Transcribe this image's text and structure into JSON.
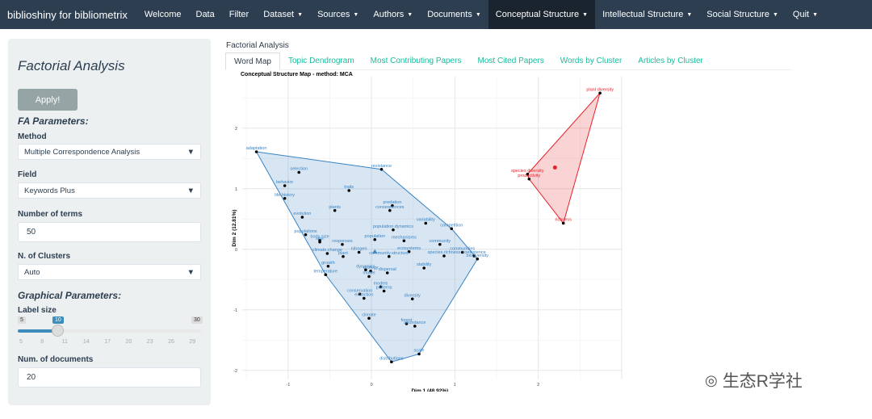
{
  "navbar": {
    "brand": "biblioshiny for bibliometrix",
    "items": [
      {
        "label": "Welcome",
        "dropdown": false
      },
      {
        "label": "Data",
        "dropdown": false
      },
      {
        "label": "Filter",
        "dropdown": false
      },
      {
        "label": "Dataset",
        "dropdown": true
      },
      {
        "label": "Sources",
        "dropdown": true
      },
      {
        "label": "Authors",
        "dropdown": true
      },
      {
        "label": "Documents",
        "dropdown": true
      },
      {
        "label": "Conceptual Structure",
        "dropdown": true,
        "active": true
      },
      {
        "label": "Intellectual Structure",
        "dropdown": true
      },
      {
        "label": "Social Structure",
        "dropdown": true
      },
      {
        "label": "Quit",
        "dropdown": true
      }
    ]
  },
  "sidebar": {
    "title": "Factorial Analysis",
    "apply": "Apply!",
    "fa_params": "FA Parameters:",
    "method_label": "Method",
    "method_value": "Multiple Correspondence Analysis",
    "field_label": "Field",
    "field_value": "Keywords Plus",
    "terms_label": "Number of terms",
    "terms_value": "50",
    "clusters_label": "N. of Clusters",
    "clusters_value": "Auto",
    "graph_params": "Graphical Parameters:",
    "label_size_label": "Label size",
    "label_size": {
      "min": "5",
      "max": "30",
      "value": "10",
      "ticks": [
        "5",
        "8",
        "11",
        "14",
        "17",
        "20",
        "23",
        "26",
        "29"
      ]
    },
    "docs_label": "Num. of documents",
    "docs_value": "20"
  },
  "main": {
    "title": "Factorial Analysis",
    "tabs": [
      "Word Map",
      "Topic Dendrogram",
      "Most Contributing Papers",
      "Most Cited Papers",
      "Words by Cluster",
      "Articles by Cluster"
    ]
  },
  "watermark": "生态R学社",
  "chart_data": {
    "type": "scatter",
    "title": "Conceptual Structure Map - method: MCA",
    "xlabel": "Dim 1 (48.92%)",
    "ylabel": "Dim 2 (12.81%)",
    "xlim": [
      -1.55,
      3.0
    ],
    "ylim": [
      -2.15,
      2.85
    ],
    "xticks": [
      "-1",
      "0",
      "1",
      "2"
    ],
    "yticks": [
      "-2",
      "-1",
      "0",
      "1",
      "2"
    ],
    "grid": true,
    "clusters": [
      {
        "color": "#3a84c4",
        "centroid": [
          0.04,
          -0.04
        ],
        "points": [
          {
            "label": "adaptation",
            "x": -1.38,
            "y": 1.61
          },
          {
            "label": "selection",
            "x": -0.87,
            "y": 1.27
          },
          {
            "label": "behavior",
            "x": -1.04,
            "y": 1.05
          },
          {
            "label": "life history",
            "x": -1.04,
            "y": 0.84
          },
          {
            "label": "traits",
            "x": -0.27,
            "y": 0.97
          },
          {
            "label": "resistance",
            "x": 0.12,
            "y": 1.32
          },
          {
            "label": "plants",
            "x": -0.44,
            "y": 0.64
          },
          {
            "label": "predation",
            "x": 0.25,
            "y": 0.72
          },
          {
            "label": "consequences",
            "x": 0.22,
            "y": 0.64
          },
          {
            "label": "evolution",
            "x": -0.83,
            "y": 0.53
          },
          {
            "label": "variability",
            "x": 0.65,
            "y": 0.43
          },
          {
            "label": "competition",
            "x": 0.96,
            "y": 0.34
          },
          {
            "label": "populations",
            "x": -0.79,
            "y": 0.24
          },
          {
            "label": "population.dynamics",
            "x": 0.26,
            "y": 0.32
          },
          {
            "label": "body size",
            "x": -0.62,
            "y": 0.15
          },
          {
            "label": "size",
            "x": -0.62,
            "y": 0.12
          },
          {
            "label": "population",
            "x": 0.04,
            "y": 0.16
          },
          {
            "label": "mechanisms",
            "x": 0.39,
            "y": 0.14
          },
          {
            "label": "community",
            "x": 0.82,
            "y": 0.08
          },
          {
            "label": "communities",
            "x": 1.09,
            "y": -0.05
          },
          {
            "label": "responses",
            "x": -0.35,
            "y": 0.08
          },
          {
            "label": "climate.change",
            "x": -0.53,
            "y": -0.07
          },
          {
            "label": "plant",
            "x": -0.34,
            "y": -0.12
          },
          {
            "label": "nitrogen",
            "x": -0.15,
            "y": -0.05
          },
          {
            "label": "ecosystems",
            "x": 0.45,
            "y": -0.04
          },
          {
            "label": "community.structure",
            "x": 0.21,
            "y": -0.12
          },
          {
            "label": "species.richness",
            "x": 0.87,
            "y": -0.11
          },
          {
            "label": "coexistence",
            "x": 1.23,
            "y": -0.11
          },
          {
            "label": "biodiversity",
            "x": 1.27,
            "y": -0.16
          },
          {
            "label": "growth",
            "x": -0.52,
            "y": -0.28
          },
          {
            "label": "dynamics",
            "x": -0.07,
            "y": -0.34
          },
          {
            "label": "ecology",
            "x": -0.01,
            "y": -0.36
          },
          {
            "label": "temperature",
            "x": -0.55,
            "y": -0.42
          },
          {
            "label": "model",
            "x": -0.03,
            "y": -0.45
          },
          {
            "label": "stability",
            "x": 0.63,
            "y": -0.31
          },
          {
            "label": "dispersal",
            "x": 0.19,
            "y": -0.39
          },
          {
            "label": "models",
            "x": 0.11,
            "y": -0.62
          },
          {
            "label": "patterns",
            "x": 0.15,
            "y": -0.69
          },
          {
            "label": "conservation",
            "x": -0.14,
            "y": -0.74
          },
          {
            "label": "extinction",
            "x": -0.09,
            "y": -0.81
          },
          {
            "label": "diversity",
            "x": 0.49,
            "y": -0.82
          },
          {
            "label": "climate",
            "x": -0.03,
            "y": -1.14
          },
          {
            "label": "forest",
            "x": 0.42,
            "y": -1.23
          },
          {
            "label": "abundance",
            "x": 0.52,
            "y": -1.27
          },
          {
            "label": "scale",
            "x": 0.57,
            "y": -1.73
          },
          {
            "label": "distributions",
            "x": 0.24,
            "y": -1.86
          }
        ]
      },
      {
        "color": "#e8212a",
        "centroid": [
          2.2,
          1.35
        ],
        "points": [
          {
            "label": "plant diversity",
            "x": 2.74,
            "y": 2.58
          },
          {
            "label": "species diversity",
            "x": 1.87,
            "y": 1.24
          },
          {
            "label": "productivity",
            "x": 1.89,
            "y": 1.16
          },
          {
            "label": "richness",
            "x": 2.3,
            "y": 0.43
          }
        ]
      }
    ]
  }
}
